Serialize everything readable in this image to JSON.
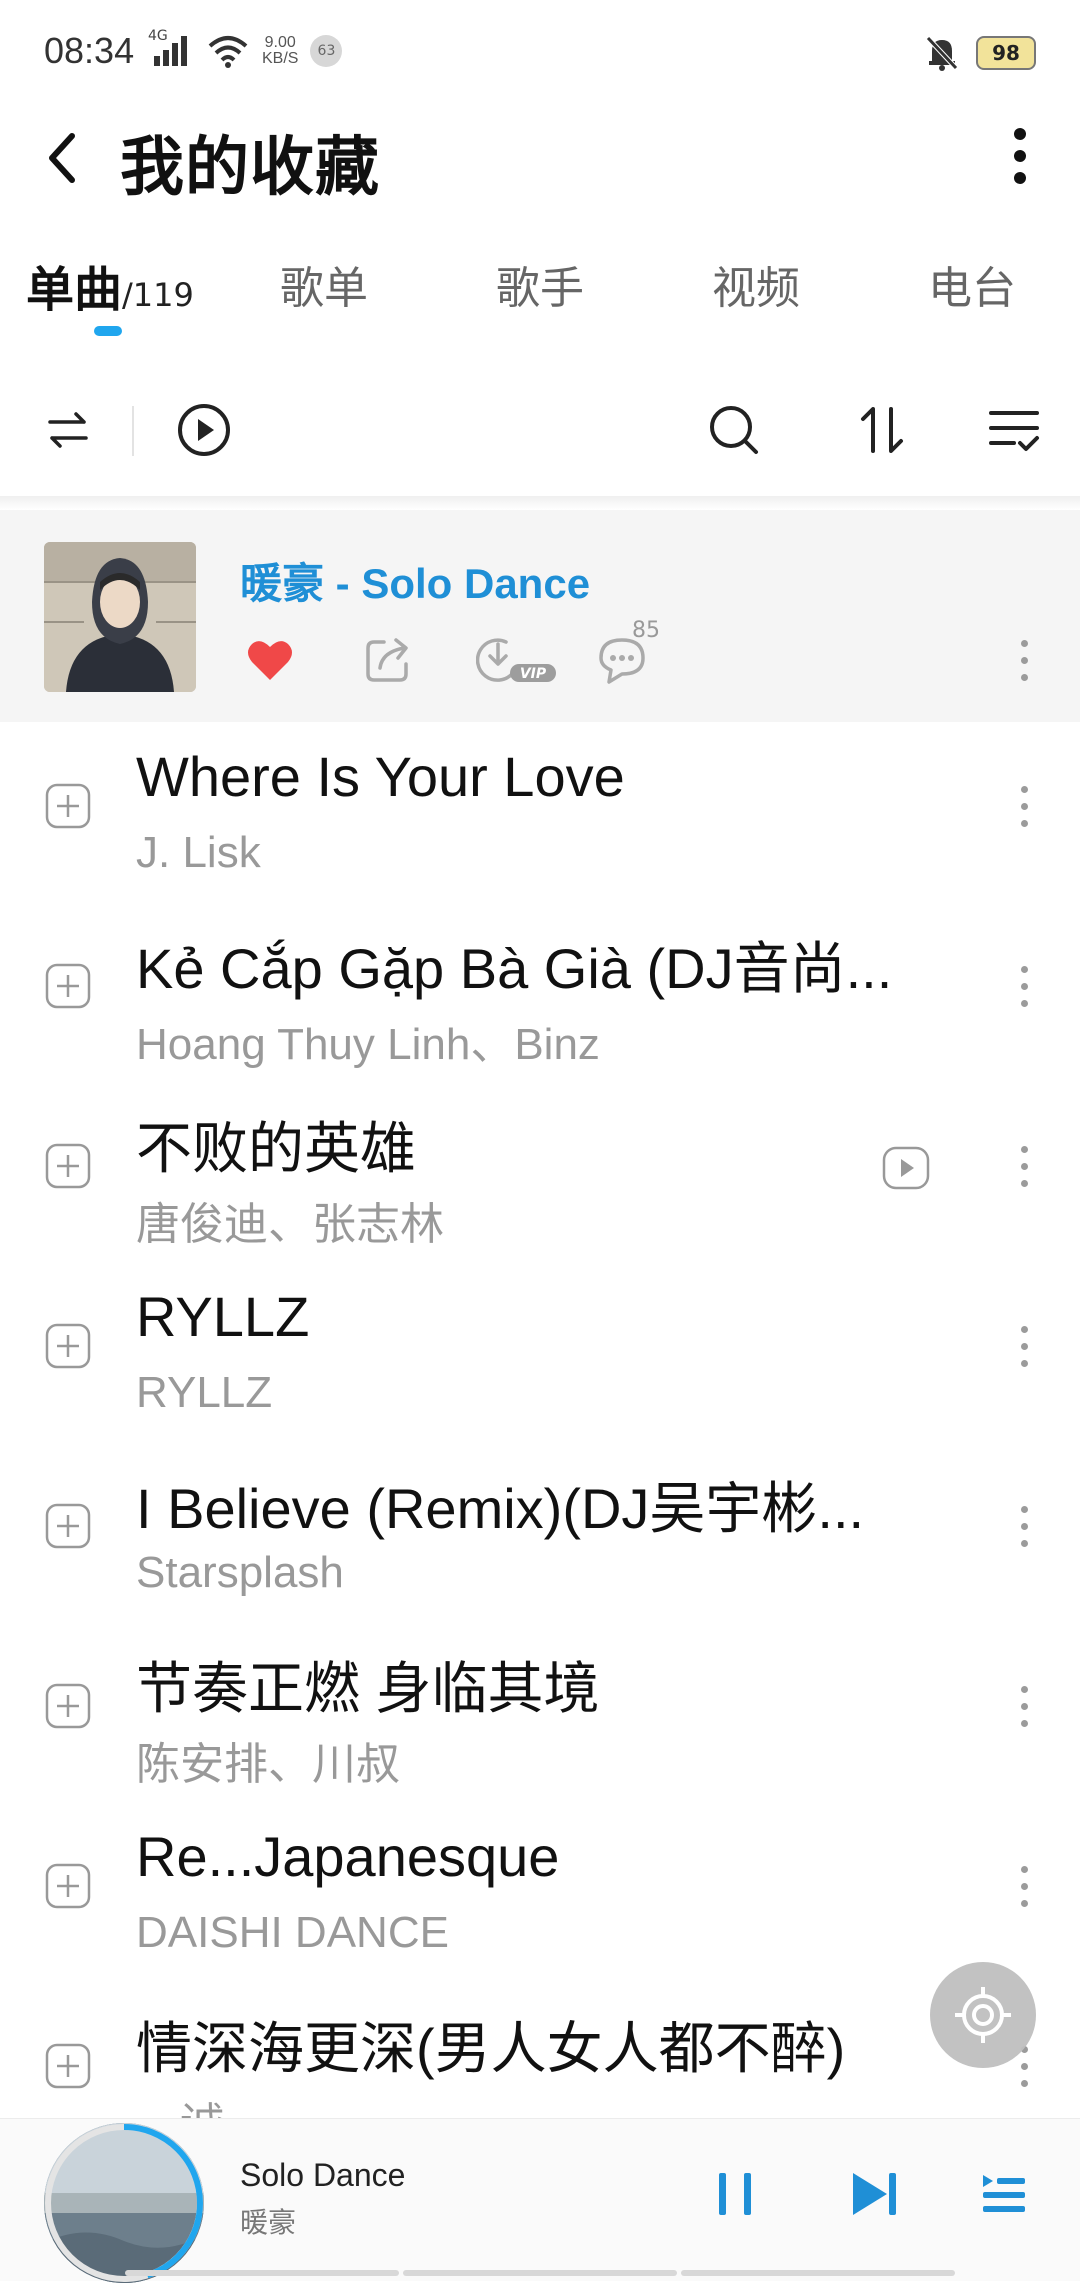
{
  "status": {
    "time": "08:34",
    "network": "4G",
    "speed_value": "9.00",
    "speed_unit": "KB/S",
    "notification_count": "63",
    "battery": "98"
  },
  "header": {
    "title": "我的收藏"
  },
  "tabs": [
    {
      "label": "单曲",
      "count": "/119",
      "active": true
    },
    {
      "label": "歌单"
    },
    {
      "label": "歌手"
    },
    {
      "label": "视频"
    },
    {
      "label": "电台"
    }
  ],
  "current": {
    "title": "暖豪 - Solo Dance",
    "comment_count": "85",
    "liked": true
  },
  "songs": [
    {
      "title": "Where Is Your Love",
      "artist": "J. Lisk"
    },
    {
      "title": "Kẻ Cắp Gặp Bà Già (DJ音尚...",
      "artist": "Hoang Thuy Linh、Binz"
    },
    {
      "title": "不败的英雄",
      "artist": "唐俊迪、张志林",
      "has_mv": true
    },
    {
      "title": "RYLLZ",
      "artist": "RYLLZ"
    },
    {
      "title": "I Believe (Remix)(DJ吴宇彬...",
      "artist": "Starsplash"
    },
    {
      "title": "节奏正燃 身临其境",
      "artist": "陈安排、川叔"
    },
    {
      "title": "Re...Japanesque",
      "artist": "DAISHI DANCE"
    },
    {
      "title": "情深海更深(男人女人都不醉)",
      "artist": "诚"
    }
  ],
  "player": {
    "title": "Solo Dance",
    "artist": "暖豪",
    "progress": 0.45
  },
  "colors": {
    "accent": "#1f8fd6",
    "indicator": "#20a6ee",
    "heart": "#f04848",
    "secondary_text": "#999999"
  },
  "icons": {
    "back": "chevron-left-icon",
    "more": "vertical-dots-icon",
    "shuffle": "shuffle-icon",
    "play_all": "play-circle-icon",
    "search": "search-icon",
    "sort": "sort-icon",
    "manage": "list-check-icon",
    "like": "heart-icon",
    "share": "share-icon",
    "download": "download-vip-icon",
    "comment": "comment-icon",
    "add": "add-square-icon",
    "mv": "video-play-icon",
    "pause": "pause-icon",
    "next": "next-icon",
    "playlist": "playlist-icon"
  }
}
